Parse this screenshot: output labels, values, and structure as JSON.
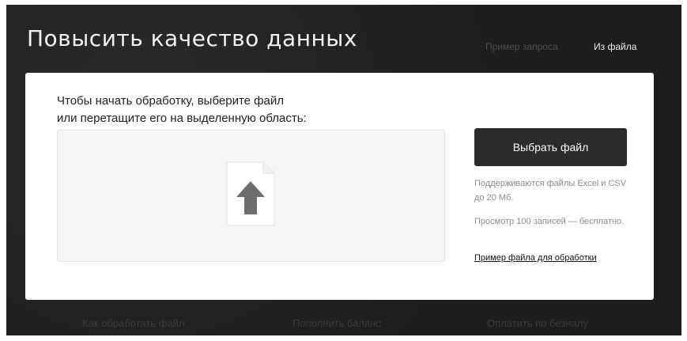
{
  "header": {
    "title": "Повысить качество данных",
    "nav_example": "Пример запроса",
    "nav_file": "Из файла"
  },
  "upload": {
    "instruction_line1": "Чтобы начать обработку, выберите файл",
    "instruction_line2": "или перетащите его на выделенную область:",
    "select_button": "Выбрать файл",
    "hint_formats": "Поддерживаются файлы Excel и CSV до 20 Мб.",
    "hint_free": "Просмотр 100 записей — бесплатно.",
    "example_link": "Пример файла для обработки"
  },
  "footer": {
    "links": [
      "Как обработать файл",
      "Пополнить баланс",
      "Оплатить по безналу"
    ]
  },
  "colors": {
    "background": "#1f1f1f",
    "card": "#ffffff",
    "button": "#2b2b2b",
    "arrow": "#6d6d6d"
  }
}
